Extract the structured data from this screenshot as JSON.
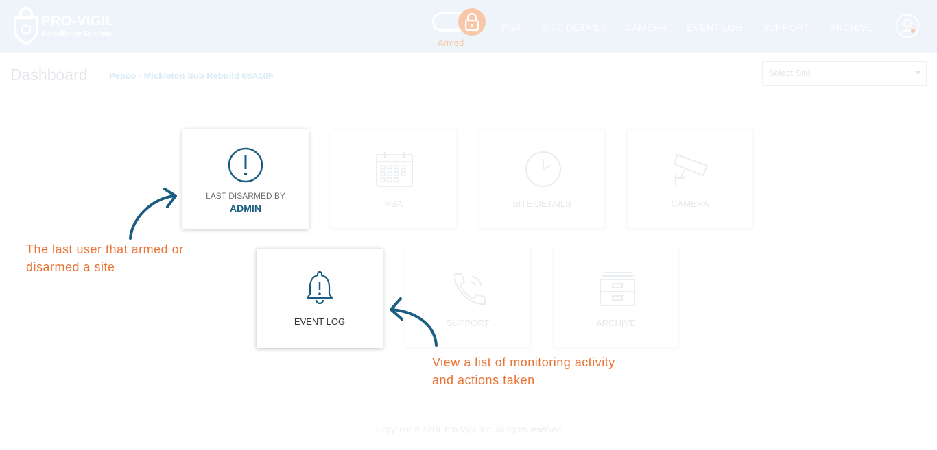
{
  "brand": {
    "name": "PRO-VIGIL",
    "subtitle": "Surveillance Services"
  },
  "arm_status": {
    "label": "Armed"
  },
  "nav": {
    "items": [
      "PSA",
      "SITE DETAILS",
      "CAMERA",
      "EVENT LOG",
      "SUPPORT",
      "ARCHIVE"
    ]
  },
  "page": {
    "title": "Dashboard",
    "site_name": "Pepco - Mickleton Sub Rebuild 68A10F"
  },
  "site_select": {
    "placeholder": "Select Site"
  },
  "tiles": {
    "last_disarmed": {
      "label": "LAST DISARMED BY",
      "value": "ADMIN",
      "icon": "exclamation-circle-icon"
    },
    "psa": {
      "label": "PSA",
      "icon": "calendar-icon"
    },
    "site_details": {
      "label": "SITE DETAILS",
      "icon": "clock-icon"
    },
    "camera": {
      "label": "CAMERA",
      "icon": "security-camera-icon"
    },
    "event_log": {
      "label": "EVENT LOG",
      "icon": "bell-alert-icon"
    },
    "support": {
      "label": "SUPPORT",
      "icon": "phone-icon"
    },
    "archive": {
      "label": "ARCHIVE",
      "icon": "archive-drawer-icon"
    }
  },
  "callouts": {
    "last_user": [
      "The last user that armed or",
      "disarmed a site"
    ],
    "event_log": [
      "View a list of monitoring activity",
      "and actions taken"
    ]
  },
  "footer": {
    "copyright": "Copyright © 2019, Pro-Vigil, Inc. All rights reserved"
  },
  "colors": {
    "accent_orange": "#ea7435",
    "icon_blue": "#1a5d80",
    "header_bg": "#eef4f9"
  }
}
